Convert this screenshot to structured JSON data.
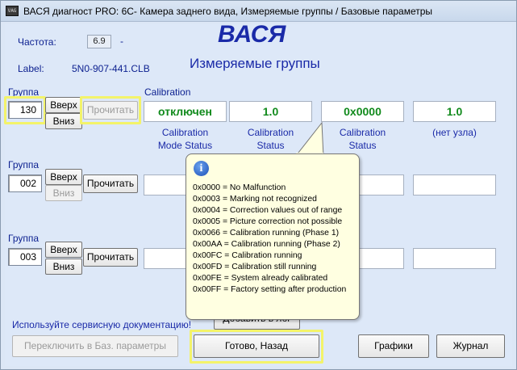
{
  "window": {
    "title": "ВАСЯ диагност PRO: 6C- Камера заднего вида,  Измеряемые группы / Базовые параметры",
    "app_icon_text": "VAG"
  },
  "header": {
    "freq_label": "Частота:",
    "freq_value": "6.9",
    "freq_dash": "-",
    "label_label": "Label:",
    "label_value": "5N0-907-441.CLB",
    "brand": "ВАСЯ",
    "subtitle": "Измеряемые группы"
  },
  "groups": [
    {
      "label": "Группа",
      "number": "130",
      "up": "Вверх",
      "down": "Вниз",
      "read": "Прочитать",
      "group_caption": "Calibration",
      "values": [
        "отключен",
        "1.0",
        "0x0000",
        "1.0"
      ],
      "captions": [
        "Calibration\nMode Status",
        "Calibration\nStatus",
        "Calibration\nStatus",
        "(нет узла)"
      ]
    },
    {
      "label": "Группа",
      "number": "002",
      "up": "Вверх",
      "down": "Вниз",
      "read": "Прочитать"
    },
    {
      "label": "Группа",
      "number": "003",
      "up": "Вверх",
      "down": "Вниз",
      "read": "Прочитать"
    }
  ],
  "tooltip": {
    "icon": "info-icon",
    "lines": [
      "0x0000 = No Malfunction",
      "0x0003 = Marking not recognized",
      "0x0004 = Correction values out of range",
      "0x0005 = Picture correction not possible",
      "0x0066 = Calibration running (Phase 1)",
      "0x00AA = Calibration running (Phase 2)",
      "0x00FC = Calibration running",
      "0x00FD = Calibration still running",
      "0x00FE = System already calibrated",
      "0x00FF = Factory setting after production"
    ]
  },
  "footer": {
    "note": "Используйте сервисную документацию!",
    "add_log": "Добавить в лог",
    "switch_basic": "Переключить в Баз. параметры",
    "done_back": "Готово, Назад",
    "graphs": "Графики",
    "journal": "Журнал"
  },
  "colors": {
    "label_blue": "#1a2aa8",
    "value_green": "#118a1c",
    "highlight_yellow": "#f3f36a",
    "tooltip_bg": "#ffffe1"
  }
}
